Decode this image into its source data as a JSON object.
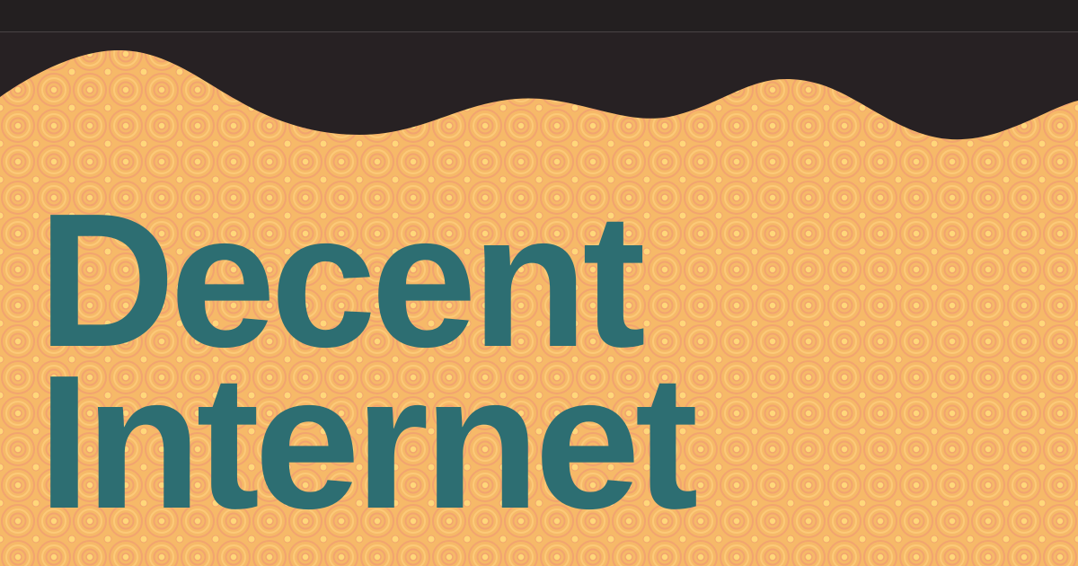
{
  "headline": {
    "line1": "Decent",
    "line2": "Internet"
  },
  "colors": {
    "background_dark": "#231f20",
    "panel_base": "#f6b968",
    "ring_pattern": "#f4a972",
    "ring_highlight": "#ffd77a",
    "headline": "#2d6e72"
  },
  "decor": {
    "pattern": "concentric-circles",
    "edge": "wavy-top"
  }
}
